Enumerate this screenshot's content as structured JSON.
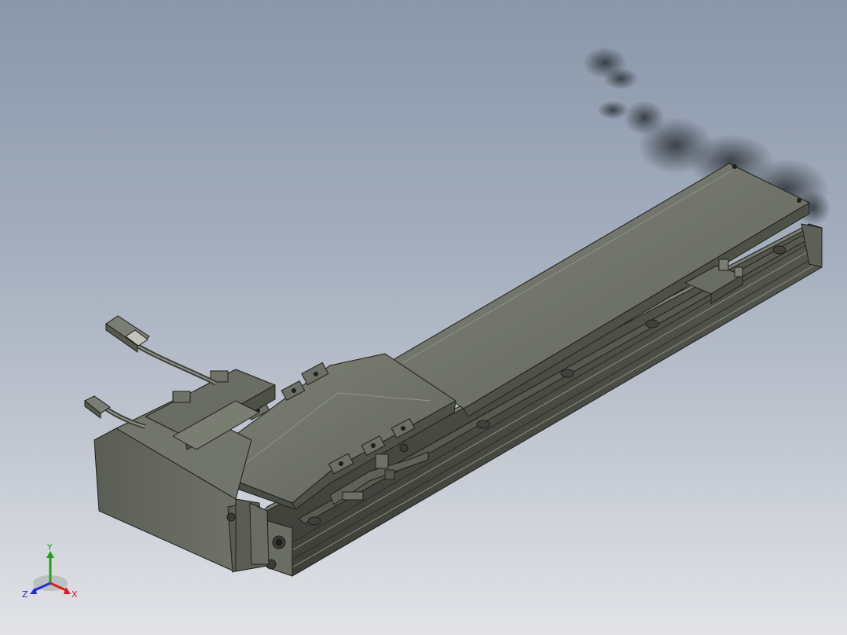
{
  "viewport": {
    "background_top": "#8a97aa",
    "background_bottom": "#e2e3e7",
    "model_color": "#6f7267",
    "edge_color": "#1e1f1c"
  },
  "triad": {
    "x_label": "X",
    "y_label": "Y",
    "z_label": "Z",
    "x_color": "#d42020",
    "y_color": "#1ea01e",
    "z_color": "#2030d8"
  }
}
